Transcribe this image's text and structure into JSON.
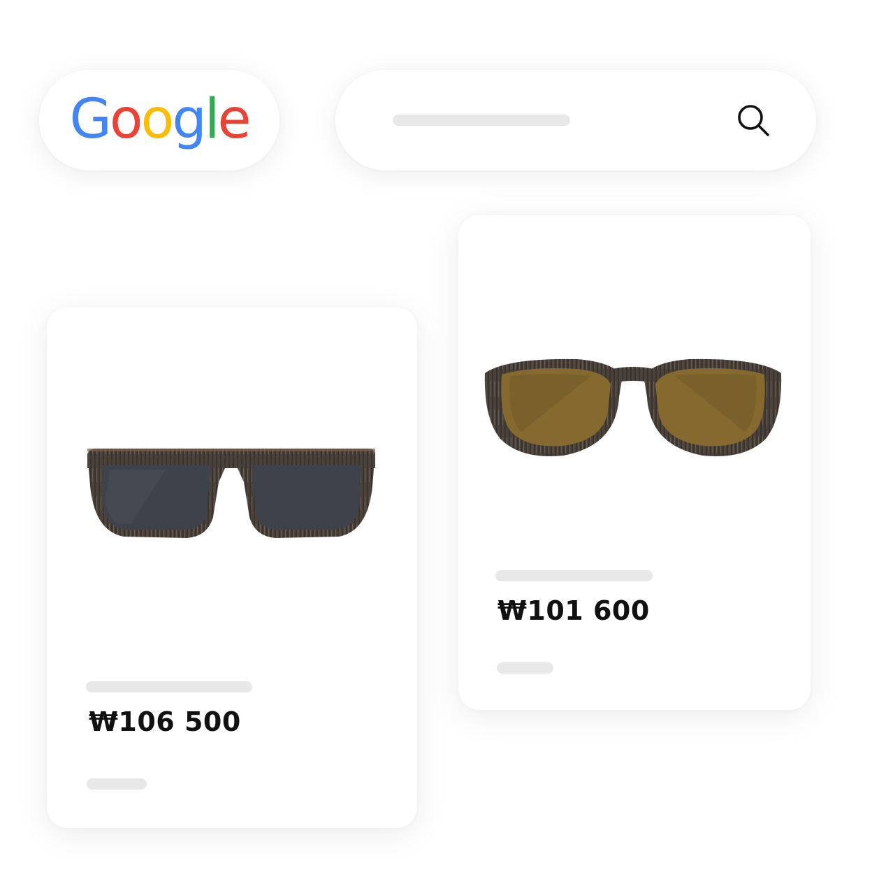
{
  "header": {
    "logo_letters": [
      {
        "char": "G",
        "color": "#4285F4"
      },
      {
        "char": "o",
        "color": "#EA4335"
      },
      {
        "char": "o",
        "color": "#FBBC05"
      },
      {
        "char": "g",
        "color": "#4285F4"
      },
      {
        "char": "l",
        "color": "#34A853"
      },
      {
        "char": "e",
        "color": "#EA4335"
      }
    ],
    "search_icon": "search-icon"
  },
  "products": [
    {
      "price": "₩106 500",
      "image": "rectangular-sunglasses-wood-frame-dark-lenses"
    },
    {
      "price": "₩101 600",
      "image": "round-sunglasses-wood-frame-brown-lenses"
    }
  ],
  "colors": {
    "skeleton": "#e8e8e8",
    "text": "#111111",
    "wood_dark": "#4a3f38",
    "lens_dark": "#3d4148",
    "lens_brown": "#8a6a2c"
  }
}
